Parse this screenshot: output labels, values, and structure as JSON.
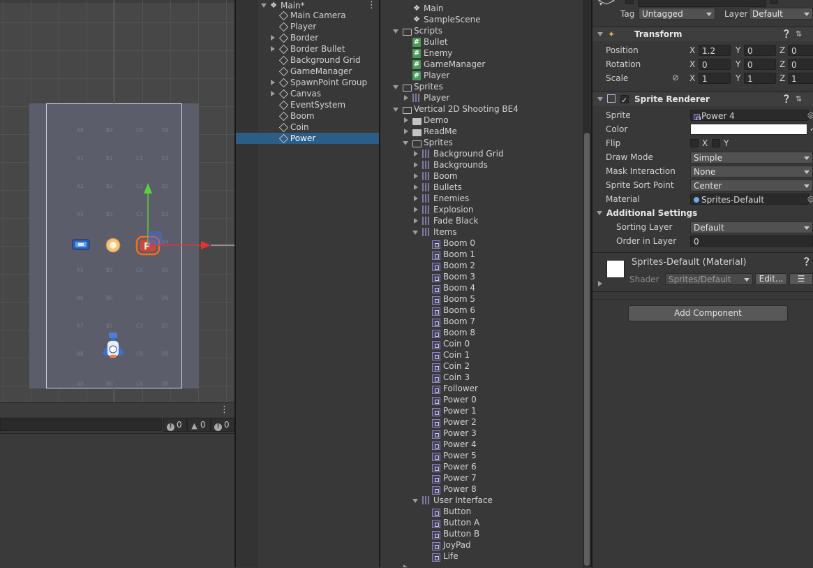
{
  "hierarchy": {
    "scene_name": "Main*",
    "items": [
      {
        "label": "Main Camera",
        "expandable": false
      },
      {
        "label": "Player",
        "expandable": false
      },
      {
        "label": "Border",
        "expandable": true
      },
      {
        "label": "Border Bullet",
        "expandable": true
      },
      {
        "label": "Background Grid",
        "expandable": false
      },
      {
        "label": "GameManager",
        "expandable": false
      },
      {
        "label": "SpawnPoint Group",
        "expandable": true
      },
      {
        "label": "Canvas",
        "expandable": true
      },
      {
        "label": "EventSystem",
        "expandable": false
      },
      {
        "label": "Boom",
        "expandable": false
      },
      {
        "label": "Coin",
        "expandable": false
      },
      {
        "label": "Power",
        "expandable": false,
        "selected": true
      }
    ]
  },
  "console": {
    "error_count": "0",
    "warning_count": "0",
    "info_count": "0"
  },
  "project": {
    "rows": [
      {
        "label": "Main",
        "icon": "unity-scene-icon",
        "indent": 2
      },
      {
        "label": "SampleScene",
        "icon": "unity-scene-icon",
        "indent": 2
      },
      {
        "label": "Scripts",
        "icon": "folder-open-icon",
        "indent": 1,
        "arrow": "down"
      },
      {
        "label": "Bullet",
        "icon": "csharp-script-icon",
        "indent": 2
      },
      {
        "label": "Enemy",
        "icon": "csharp-script-icon",
        "indent": 2
      },
      {
        "label": "GameManager",
        "icon": "csharp-script-icon",
        "indent": 2
      },
      {
        "label": "Player",
        "icon": "csharp-script-icon",
        "indent": 2
      },
      {
        "label": "Sprites",
        "icon": "folder-open-icon",
        "indent": 1,
        "arrow": "down"
      },
      {
        "label": "Player",
        "icon": "sprite-sheet-icon",
        "indent": 2,
        "arrow": "right"
      },
      {
        "label": "Vertical 2D Shooting BE4",
        "icon": "folder-open-icon",
        "indent": 1,
        "arrow": "down"
      },
      {
        "label": "Demo",
        "icon": "folder-icon",
        "indent": 2,
        "arrow": "right"
      },
      {
        "label": "ReadMe",
        "icon": "folder-icon",
        "indent": 2,
        "arrow": "right"
      },
      {
        "label": "Sprites",
        "icon": "folder-open-icon",
        "indent": 2,
        "arrow": "down"
      },
      {
        "label": "Background Grid",
        "icon": "sprite-sheet-icon",
        "indent": 3,
        "arrow": "right"
      },
      {
        "label": "Backgrounds",
        "icon": "sprite-sheet-icon",
        "indent": 3,
        "arrow": "right"
      },
      {
        "label": "Boom",
        "icon": "sprite-sheet-icon",
        "indent": 3,
        "arrow": "right"
      },
      {
        "label": "Bullets",
        "icon": "sprite-sheet-icon",
        "indent": 3,
        "arrow": "right"
      },
      {
        "label": "Enemies",
        "icon": "sprite-sheet-icon",
        "indent": 3,
        "arrow": "right"
      },
      {
        "label": "Explosion",
        "icon": "sprite-sheet-icon",
        "indent": 3,
        "arrow": "right"
      },
      {
        "label": "Fade Black",
        "icon": "sprite-sheet-icon",
        "indent": 3,
        "arrow": "right"
      },
      {
        "label": "Items",
        "icon": "sprite-sheet-icon",
        "indent": 3,
        "arrow": "down"
      },
      {
        "label": "Boom 0",
        "icon": "sprite-icon",
        "indent": 4
      },
      {
        "label": "Boom 1",
        "icon": "sprite-icon",
        "indent": 4
      },
      {
        "label": "Boom 2",
        "icon": "sprite-icon",
        "indent": 4
      },
      {
        "label": "Boom 3",
        "icon": "sprite-icon",
        "indent": 4
      },
      {
        "label": "Boom 4",
        "icon": "sprite-icon",
        "indent": 4
      },
      {
        "label": "Boom 5",
        "icon": "sprite-icon",
        "indent": 4
      },
      {
        "label": "Boom 6",
        "icon": "sprite-icon",
        "indent": 4
      },
      {
        "label": "Boom 7",
        "icon": "sprite-icon",
        "indent": 4
      },
      {
        "label": "Boom 8",
        "icon": "sprite-icon",
        "indent": 4
      },
      {
        "label": "Coin 0",
        "icon": "sprite-icon",
        "indent": 4
      },
      {
        "label": "Coin 1",
        "icon": "sprite-icon",
        "indent": 4
      },
      {
        "label": "Coin 2",
        "icon": "sprite-icon",
        "indent": 4
      },
      {
        "label": "Coin 3",
        "icon": "sprite-icon",
        "indent": 4
      },
      {
        "label": "Follower",
        "icon": "sprite-icon",
        "indent": 4
      },
      {
        "label": "Power 0",
        "icon": "sprite-icon",
        "indent": 4
      },
      {
        "label": "Power 1",
        "icon": "sprite-icon",
        "indent": 4
      },
      {
        "label": "Power 2",
        "icon": "sprite-icon",
        "indent": 4
      },
      {
        "label": "Power 3",
        "icon": "sprite-icon",
        "indent": 4
      },
      {
        "label": "Power 4",
        "icon": "sprite-icon",
        "indent": 4
      },
      {
        "label": "Power 5",
        "icon": "sprite-icon",
        "indent": 4
      },
      {
        "label": "Power 6",
        "icon": "sprite-icon",
        "indent": 4
      },
      {
        "label": "Power 7",
        "icon": "sprite-icon",
        "indent": 4
      },
      {
        "label": "Power 8",
        "icon": "sprite-icon",
        "indent": 4
      },
      {
        "label": "User Interface",
        "icon": "sprite-sheet-icon",
        "indent": 3,
        "arrow": "down"
      },
      {
        "label": "Button",
        "icon": "sprite-icon",
        "indent": 4
      },
      {
        "label": "Button A",
        "icon": "sprite-icon",
        "indent": 4
      },
      {
        "label": "Button B",
        "icon": "sprite-icon",
        "indent": 4
      },
      {
        "label": "JoyPad",
        "icon": "sprite-icon",
        "indent": 4
      },
      {
        "label": "Life",
        "icon": "sprite-icon",
        "indent": 4
      }
    ]
  },
  "inspector": {
    "tag_label": "Tag",
    "tag_value": "Untagged",
    "layer_label": "Layer",
    "layer_value": "Default",
    "transform": {
      "title": "Transform",
      "position_label": "Position",
      "rotation_label": "Rotation",
      "scale_label": "Scale",
      "x": "X",
      "y": "Y",
      "z": "Z",
      "position": {
        "x": "1.2",
        "y": "0",
        "z": "0"
      },
      "rotation": {
        "x": "0",
        "y": "0",
        "z": "0"
      },
      "scale": {
        "x": "1",
        "y": "1",
        "z": "1"
      }
    },
    "sprite_renderer": {
      "title": "Sprite Renderer",
      "sprite_label": "Sprite",
      "sprite_value": "Power 4",
      "color_label": "Color",
      "color_value": "#ffffff",
      "flip_label": "Flip",
      "flip_x": "X",
      "flip_y": "Y",
      "draw_mode_label": "Draw Mode",
      "draw_mode_value": "Simple",
      "mask_label": "Mask Interaction",
      "mask_value": "None",
      "sort_point_label": "Sprite Sort Point",
      "sort_point_value": "Center",
      "material_label": "Material",
      "material_value": "Sprites-Default",
      "additional_settings": "Additional Settings",
      "sorting_layer_label": "Sorting Layer",
      "sorting_layer_value": "Default",
      "order_label": "Order in Layer",
      "order_value": "0"
    },
    "material_panel": {
      "title": "Sprites-Default (Material)",
      "shader_label": "Shader",
      "shader_value": "Sprites/Default",
      "edit_label": "Edit..."
    },
    "add_component_label": "Add Component"
  },
  "colors": {
    "selection": "#2c5d87",
    "gizmo_x": "#e23434",
    "gizmo_y": "#5bd13c",
    "gizmo_handle": "#4a68c9"
  }
}
